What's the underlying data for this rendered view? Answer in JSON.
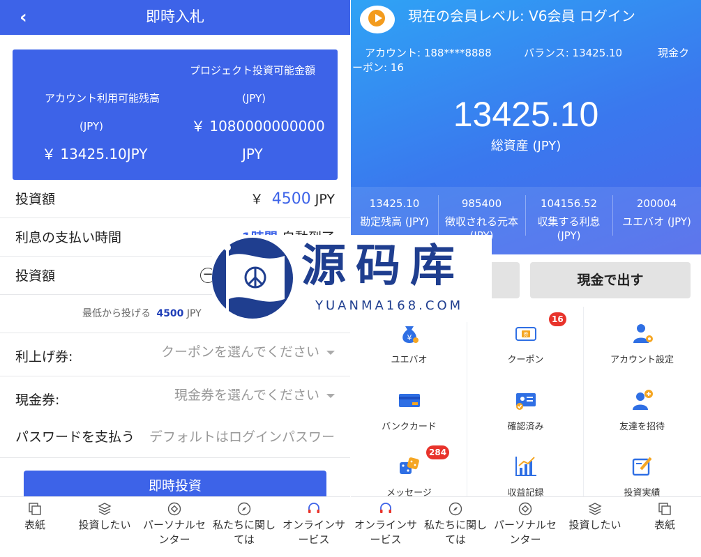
{
  "left": {
    "header": {
      "title": "即時入札",
      "back_icon": "chevron-left-icon"
    },
    "card": {
      "project_label": "プロジェクト投資可能金額",
      "project_currency": "(JPY)",
      "project_value": "￥ 1080000000000",
      "project_unit": "JPY",
      "account_label": "アカウント利用可能残高",
      "account_currency": "(JPY)",
      "account_value": "￥ 13425.10JPY"
    },
    "rows": {
      "amount_label": "投資額",
      "amount_symbol": "￥",
      "amount_value": "4500",
      "amount_unit": "JPY",
      "interest_label": "利息の支払い時間",
      "interest_value_hl": "1時間",
      "interest_value": "自動到了",
      "stepper_label": "投資額",
      "min_text_prefix": "最低から投げる",
      "min_value": "4500",
      "min_unit": "JPY",
      "boost_label": "利上げ券:",
      "boost_placeholder": "クーポンを選んでください",
      "cash_label": "現金券:",
      "cash_placeholder": "現金券を選んでください",
      "pw_label": "パスワードを支払う",
      "pw_placeholder": "デフォルトはログインパスワー"
    },
    "invest_button": "即時投資",
    "tabs": [
      {
        "label": "表紙",
        "icon": "home-icon"
      },
      {
        "label": "投資したい",
        "icon": "layers-icon"
      },
      {
        "label": "パーソナルセンター",
        "icon": "user-circle-icon"
      },
      {
        "label": "私たちに関しては",
        "icon": "compass-icon"
      },
      {
        "label": "オンラインサービス",
        "icon": "headset-icon"
      }
    ]
  },
  "right": {
    "level_text": "現在の会員レベル: V6会員  ログイン",
    "account_text": "アカウント: 188****8888",
    "balance_text": "バランス: 13425.10",
    "coupon_text_1": "現金ク",
    "coupon_text_2": "ーポン: 16",
    "total_value": "13425.10",
    "total_label": "総資産 (JPY)",
    "stats": [
      {
        "value": "13425.10",
        "label": "勘定残高 (JPY)"
      },
      {
        "value": "985400",
        "label": "徴収される元本 (JPY)"
      },
      {
        "value": "104156.52",
        "label": "収集する利息 (JPY)"
      },
      {
        "value": "200004",
        "label": "ユエバオ (JPY)"
      }
    ],
    "withdraw_button": "現金で出す",
    "grid": [
      {
        "label": "ユエバオ",
        "icon": "money-bag-icon",
        "badge": ""
      },
      {
        "label": "クーポン",
        "icon": "coupon-icon",
        "badge": "16"
      },
      {
        "label": "アカウント設定",
        "icon": "account-settings-icon",
        "badge": ""
      },
      {
        "label": "バンクカード",
        "icon": "bank-card-icon",
        "badge": ""
      },
      {
        "label": "確認済み",
        "icon": "verified-card-icon",
        "badge": ""
      },
      {
        "label": "友達を招待",
        "icon": "invite-friend-icon",
        "badge": ""
      },
      {
        "label": "メッセージ",
        "icon": "dice-message-icon",
        "badge": "284"
      },
      {
        "label": "収益記録",
        "icon": "chart-icon",
        "badge": ""
      },
      {
        "label": "投資実績",
        "icon": "edit-record-icon",
        "badge": ""
      }
    ],
    "tabs": [
      {
        "label": "オンラインサービス",
        "icon": "headset-icon"
      },
      {
        "label": "私たちに関しては",
        "icon": "compass-icon"
      },
      {
        "label": "パーソナルセンター",
        "icon": "user-circle-icon"
      },
      {
        "label": "投資したい",
        "icon": "layers-icon"
      },
      {
        "label": "表紙",
        "icon": "home-icon"
      }
    ]
  },
  "watermark": {
    "title": "源码库",
    "subtitle": "YUANMA168.COM"
  },
  "colors": {
    "primary": "#3d63e8",
    "badge": "#e8332b",
    "hero_top": "#2fa3f5",
    "accent_blue": "#1f3e8f"
  }
}
